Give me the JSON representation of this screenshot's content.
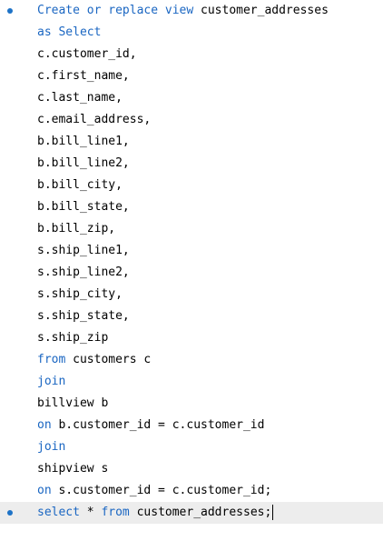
{
  "editor": {
    "lines": [
      {
        "marker": true,
        "parts": [
          {
            "t": "Create or replace view",
            "k": true
          },
          {
            "t": " customer_addresses",
            "k": false
          }
        ]
      },
      {
        "marker": false,
        "parts": [
          {
            "t": "as Select",
            "k": true
          }
        ]
      },
      {
        "marker": false,
        "parts": [
          {
            "t": "c.customer_id,",
            "k": false
          }
        ]
      },
      {
        "marker": false,
        "parts": [
          {
            "t": "c.first_name,",
            "k": false
          }
        ]
      },
      {
        "marker": false,
        "parts": [
          {
            "t": "c.last_name,",
            "k": false
          }
        ]
      },
      {
        "marker": false,
        "parts": [
          {
            "t": "c.email_address,",
            "k": false
          }
        ]
      },
      {
        "marker": false,
        "parts": [
          {
            "t": "b.bill_line1,",
            "k": false
          }
        ]
      },
      {
        "marker": false,
        "parts": [
          {
            "t": "b.bill_line2,",
            "k": false
          }
        ]
      },
      {
        "marker": false,
        "parts": [
          {
            "t": "b.bill_city,",
            "k": false
          }
        ]
      },
      {
        "marker": false,
        "parts": [
          {
            "t": "b.bill_state,",
            "k": false
          }
        ]
      },
      {
        "marker": false,
        "parts": [
          {
            "t": "b.bill_zip,",
            "k": false
          }
        ]
      },
      {
        "marker": false,
        "parts": [
          {
            "t": "s.ship_line1,",
            "k": false
          }
        ]
      },
      {
        "marker": false,
        "parts": [
          {
            "t": "s.ship_line2,",
            "k": false
          }
        ]
      },
      {
        "marker": false,
        "parts": [
          {
            "t": "s.ship_city,",
            "k": false
          }
        ]
      },
      {
        "marker": false,
        "parts": [
          {
            "t": "s.ship_state,",
            "k": false
          }
        ]
      },
      {
        "marker": false,
        "parts": [
          {
            "t": "s.ship_zip",
            "k": false
          }
        ]
      },
      {
        "marker": false,
        "parts": [
          {
            "t": "from",
            "k": true
          },
          {
            "t": " customers c",
            "k": false
          }
        ]
      },
      {
        "marker": false,
        "parts": [
          {
            "t": "join",
            "k": true
          }
        ]
      },
      {
        "marker": false,
        "parts": [
          {
            "t": "billview b",
            "k": false
          }
        ]
      },
      {
        "marker": false,
        "parts": [
          {
            "t": "on",
            "k": true
          },
          {
            "t": " b.customer_id = c.customer_id",
            "k": false
          }
        ]
      },
      {
        "marker": false,
        "parts": [
          {
            "t": "join",
            "k": true
          }
        ]
      },
      {
        "marker": false,
        "parts": [
          {
            "t": "shipview s",
            "k": false
          }
        ]
      },
      {
        "marker": false,
        "parts": [
          {
            "t": "on",
            "k": true
          },
          {
            "t": " s.customer_id = c.customer_id;",
            "k": false
          }
        ]
      },
      {
        "marker": true,
        "current": true,
        "caret": true,
        "parts": [
          {
            "t": "select",
            "k": true
          },
          {
            "t": " * ",
            "k": false
          },
          {
            "t": "from",
            "k": true
          },
          {
            "t": " customer_addresses;",
            "k": false
          }
        ]
      }
    ]
  },
  "colors": {
    "keyword": "#1a66c2",
    "identifier": "#000000",
    "statement_marker": "#1e73c7",
    "current_line_background": "#ededed"
  }
}
